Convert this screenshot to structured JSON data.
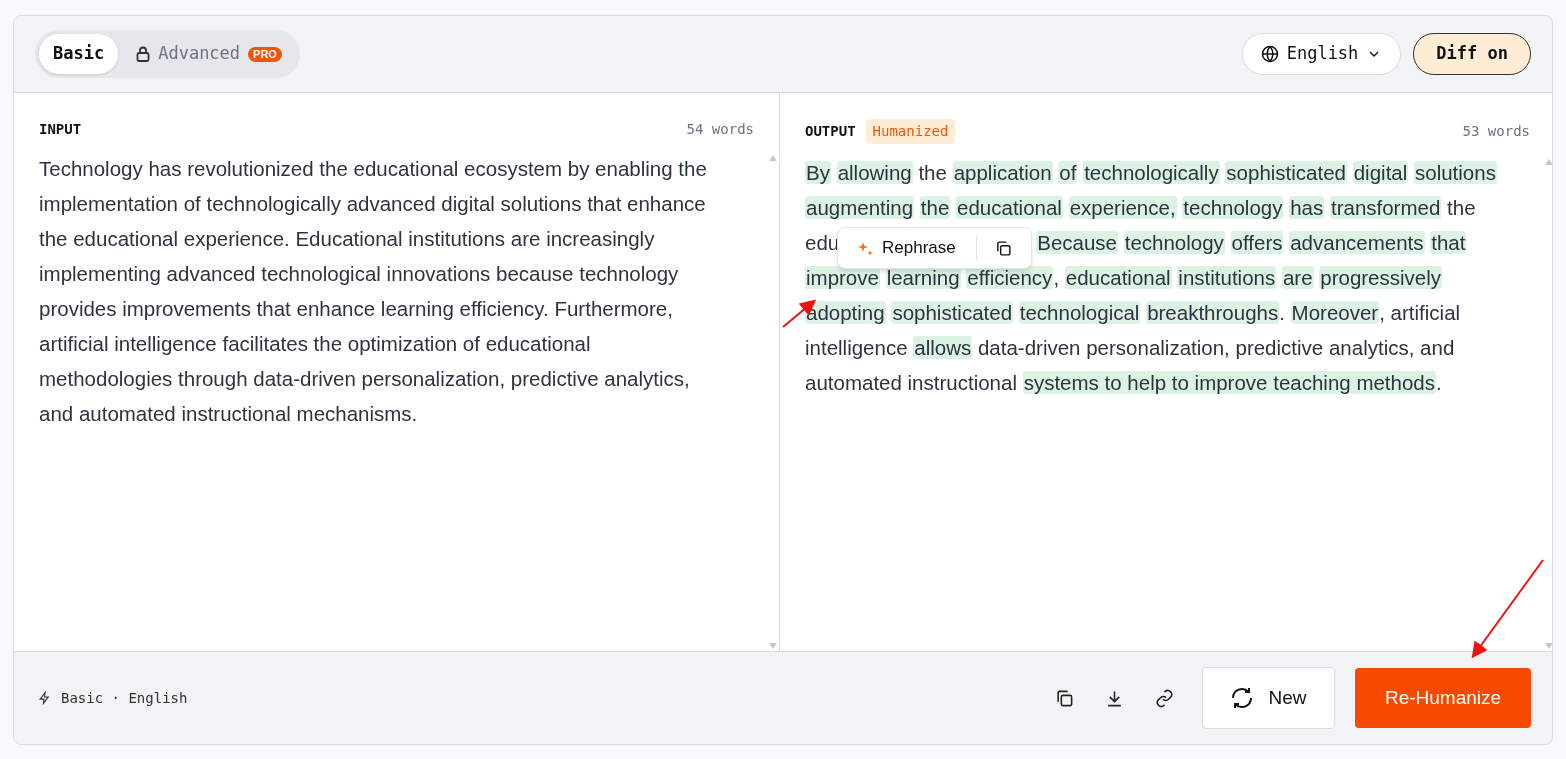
{
  "mode_tabs": [
    {
      "label": "Basic",
      "selected": true,
      "locked": false
    },
    {
      "label": "Advanced",
      "selected": false,
      "locked": true,
      "badge": "PRO"
    }
  ],
  "language": "English",
  "diff_toggle": {
    "label": "Diff on",
    "on": true
  },
  "input": {
    "title": "INPUT",
    "count": "54 words",
    "lines": [
      "Technology has revolutionized the educational ecosystem by enabling the",
      "implementation of technologically advanced digital solutions that enhance",
      "the educational experience. Educational institutions are increasingly",
      "implementing advanced technological innovations because technology",
      "provides improvements that enhance learning efficiency. Furthermore,",
      "artificial intelligence facilitates the optimization of educational",
      "methodologies through data-driven personalization, predictive analytics,",
      "and automated instructional mechanisms."
    ]
  },
  "output": {
    "title": "OUTPUT",
    "badge": "Humanized",
    "count": "53 words",
    "lines": [
      [
        {
          "text": "By",
          "changed": true
        },
        {
          "text": "allowing",
          "changed": true
        },
        {
          "text": "the",
          "changed": false
        },
        {
          "text": "application",
          "changed": true
        },
        {
          "text": "of",
          "changed": true
        },
        {
          "text": "technologically",
          "changed": true
        },
        {
          "text": "sophisticated",
          "changed": true
        },
        {
          "text": "digital",
          "changed": true
        },
        {
          "text": "solutions",
          "changed": true
        }
      ],
      [
        {
          "text": "augmenting",
          "changed": true
        },
        {
          "text": "the",
          "changed": true
        },
        {
          "text": "educational",
          "changed": true
        },
        {
          "text": "experience,",
          "changed": true
        },
        {
          "text": "technology",
          "changed": true
        },
        {
          "text": "has",
          "changed": true
        },
        {
          "text": "transformed",
          "changed": true
        },
        {
          "text": "the",
          "changed": false
        }
      ],
      [
        {
          "text": "edu",
          "changed": false,
          "kind": "cut"
        },
        {
          "text": "Because",
          "changed": true
        },
        {
          "text": "technology",
          "changed": true
        },
        {
          "text": "offers",
          "changed": true
        },
        {
          "text": "advancements",
          "changed": true
        },
        {
          "text": "that",
          "changed": true
        }
      ],
      [
        {
          "text": "improve",
          "changed": true
        },
        {
          "text": "learning",
          "changed": true
        },
        {
          "text": "efficiency",
          "changed": true,
          "tail": ","
        },
        {
          "text": "educational",
          "changed": true
        },
        {
          "text": "institutions",
          "changed": true
        },
        {
          "text": "are",
          "changed": true
        },
        {
          "text": "progressively",
          "changed": true
        }
      ],
      [
        {
          "text": "adopting",
          "changed": true
        },
        {
          "text": "sophisticated",
          "changed": true
        },
        {
          "text": "technological",
          "changed": true
        },
        {
          "text": "breakthroughs",
          "changed": true,
          "tail": "."
        },
        {
          "text": "Moreover",
          "changed": true,
          "tail": ","
        },
        {
          "text": "artificial",
          "changed": false
        }
      ],
      [
        {
          "text": "intelligence",
          "changed": false
        },
        {
          "text": "allows",
          "changed": true
        },
        {
          "text": "data-driven personalization, predictive analytics, and",
          "changed": false
        }
      ],
      [
        {
          "text": "automated instructional",
          "changed": false
        },
        {
          "text": "systems to help to improve teaching methods",
          "changed": true,
          "tail": "."
        }
      ]
    ]
  },
  "popup": {
    "label": "Rephrase"
  },
  "footer": {
    "status": "Basic · English",
    "new_label": "New",
    "primary_label": "Re-Humanize"
  }
}
